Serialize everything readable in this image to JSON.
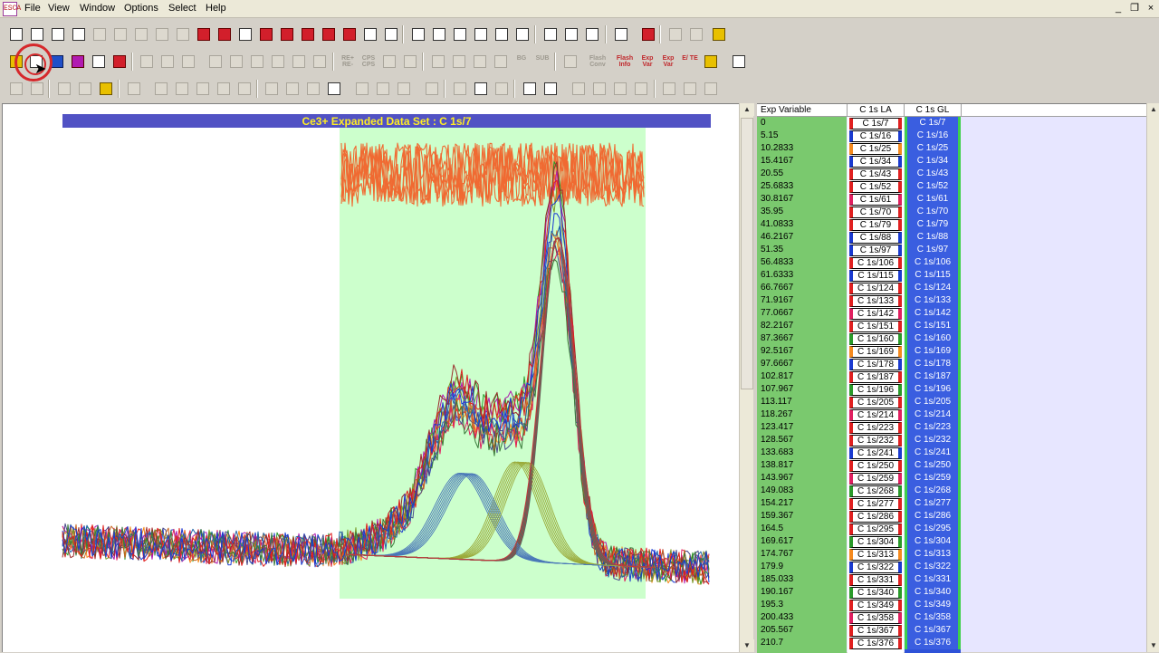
{
  "app": {
    "icon_text": "ESCA"
  },
  "menu": [
    "File",
    "View",
    "Window",
    "Options",
    "Select",
    "Help"
  ],
  "window_controls": {
    "minimize": "_",
    "restore": "❐",
    "close": "×"
  },
  "toolbar_buttons": {
    "row2": [
      "",
      "",
      "",
      "",
      "",
      "",
      "",
      "",
      "",
      "",
      "",
      "",
      "",
      "",
      "",
      "RE+\nRE-",
      "CPS\nCPS",
      "",
      "",
      "",
      "",
      "",
      "",
      "BG",
      "SUB",
      "",
      "Flash\nConv",
      "Flash\nInfo",
      "Exp\nVar",
      "Exp\nVar",
      "E/\nTE",
      "",
      "",
      "EDIT\nMODE"
    ],
    "row3": [
      "",
      "",
      "",
      "",
      "",
      "",
      "",
      "",
      "",
      "",
      "",
      "",
      "",
      "",
      "",
      "ToF\nEXTR",
      "",
      "",
      "",
      "",
      "",
      "",
      "",
      "",
      "",
      "",
      "",
      "",
      "",
      "",
      "",
      "",
      ""
    ]
  },
  "plot": {
    "title": "Ce3+ Expanded Data Set : C 1s/7",
    "title_bg": "#5152c4",
    "title_color": "#ffee22",
    "region_color": "#ccffcc",
    "residual_color": "#f06a32"
  },
  "grid": {
    "columns": [
      "Exp Variable",
      "C 1s LA",
      "C 1s GL"
    ],
    "rows": [
      {
        "exp": "0",
        "la": "C 1s/7",
        "gl": "C 1s/7",
        "color": "#e02020"
      },
      {
        "exp": "5.15",
        "la": "C 1s/16",
        "gl": "C 1s/16",
        "color": "#1a3ad0"
      },
      {
        "exp": "10.2833",
        "la": "C 1s/25",
        "gl": "C 1s/25",
        "color": "#f58a1e"
      },
      {
        "exp": "15.4167",
        "la": "C 1s/34",
        "gl": "C 1s/34",
        "color": "#1a3ad0"
      },
      {
        "exp": "20.55",
        "la": "C 1s/43",
        "gl": "C 1s/43",
        "color": "#e02020"
      },
      {
        "exp": "25.6833",
        "la": "C 1s/52",
        "gl": "C 1s/52",
        "color": "#e02020"
      },
      {
        "exp": "30.8167",
        "la": "C 1s/61",
        "gl": "C 1s/61",
        "color": "#e02060"
      },
      {
        "exp": "35.95",
        "la": "C 1s/70",
        "gl": "C 1s/70",
        "color": "#e02020"
      },
      {
        "exp": "41.0833",
        "la": "C 1s/79",
        "gl": "C 1s/79",
        "color": "#e02020"
      },
      {
        "exp": "46.2167",
        "la": "C 1s/88",
        "gl": "C 1s/88",
        "color": "#1a3ad0"
      },
      {
        "exp": "51.35",
        "la": "C 1s/97",
        "gl": "C 1s/97",
        "color": "#1a3ad0"
      },
      {
        "exp": "56.4833",
        "la": "C 1s/106",
        "gl": "C 1s/106",
        "color": "#e02020"
      },
      {
        "exp": "61.6333",
        "la": "C 1s/115",
        "gl": "C 1s/115",
        "color": "#1a3ad0"
      },
      {
        "exp": "66.7667",
        "la": "C 1s/124",
        "gl": "C 1s/124",
        "color": "#e02020"
      },
      {
        "exp": "71.9167",
        "la": "C 1s/133",
        "gl": "C 1s/133",
        "color": "#e02020"
      },
      {
        "exp": "77.0667",
        "la": "C 1s/142",
        "gl": "C 1s/142",
        "color": "#e02060"
      },
      {
        "exp": "82.2167",
        "la": "C 1s/151",
        "gl": "C 1s/151",
        "color": "#e02020"
      },
      {
        "exp": "87.3667",
        "la": "C 1s/160",
        "gl": "C 1s/160",
        "color": "#2a9a2a"
      },
      {
        "exp": "92.5167",
        "la": "C 1s/169",
        "gl": "C 1s/169",
        "color": "#f58a1e"
      },
      {
        "exp": "97.6667",
        "la": "C 1s/178",
        "gl": "C 1s/178",
        "color": "#1a3ad0"
      },
      {
        "exp": "102.817",
        "la": "C 1s/187",
        "gl": "C 1s/187",
        "color": "#e02020"
      },
      {
        "exp": "107.967",
        "la": "C 1s/196",
        "gl": "C 1s/196",
        "color": "#2a9a2a"
      },
      {
        "exp": "113.117",
        "la": "C 1s/205",
        "gl": "C 1s/205",
        "color": "#e02020"
      },
      {
        "exp": "118.267",
        "la": "C 1s/214",
        "gl": "C 1s/214",
        "color": "#e02060"
      },
      {
        "exp": "123.417",
        "la": "C 1s/223",
        "gl": "C 1s/223",
        "color": "#e02020"
      },
      {
        "exp": "128.567",
        "la": "C 1s/232",
        "gl": "C 1s/232",
        "color": "#e02020"
      },
      {
        "exp": "133.683",
        "la": "C 1s/241",
        "gl": "C 1s/241",
        "color": "#1a3ad0"
      },
      {
        "exp": "138.817",
        "la": "C 1s/250",
        "gl": "C 1s/250",
        "color": "#e02020"
      },
      {
        "exp": "143.967",
        "la": "C 1s/259",
        "gl": "C 1s/259",
        "color": "#e02060"
      },
      {
        "exp": "149.083",
        "la": "C 1s/268",
        "gl": "C 1s/268",
        "color": "#2a9a2a"
      },
      {
        "exp": "154.217",
        "la": "C 1s/277",
        "gl": "C 1s/277",
        "color": "#e02020"
      },
      {
        "exp": "159.367",
        "la": "C 1s/286",
        "gl": "C 1s/286",
        "color": "#e02020"
      },
      {
        "exp": "164.5",
        "la": "C 1s/295",
        "gl": "C 1s/295",
        "color": "#e02020"
      },
      {
        "exp": "169.617",
        "la": "C 1s/304",
        "gl": "C 1s/304",
        "color": "#2a9a2a"
      },
      {
        "exp": "174.767",
        "la": "C 1s/313",
        "gl": "C 1s/313",
        "color": "#f58a1e"
      },
      {
        "exp": "179.9",
        "la": "C 1s/322",
        "gl": "C 1s/322",
        "color": "#1a3ad0"
      },
      {
        "exp": "185.033",
        "la": "C 1s/331",
        "gl": "C 1s/331",
        "color": "#e02020"
      },
      {
        "exp": "190.167",
        "la": "C 1s/340",
        "gl": "C 1s/340",
        "color": "#2a9a2a"
      },
      {
        "exp": "195.3",
        "la": "C 1s/349",
        "gl": "C 1s/349",
        "color": "#e02020"
      },
      {
        "exp": "200.433",
        "la": "C 1s/358",
        "gl": "C 1s/358",
        "color": "#e02060"
      },
      {
        "exp": "205.567",
        "la": "C 1s/367",
        "gl": "C 1s/367",
        "color": "#e02020"
      },
      {
        "exp": "210.7",
        "la": "C 1s/376",
        "gl": "C 1s/376",
        "color": "#e02020"
      }
    ]
  }
}
